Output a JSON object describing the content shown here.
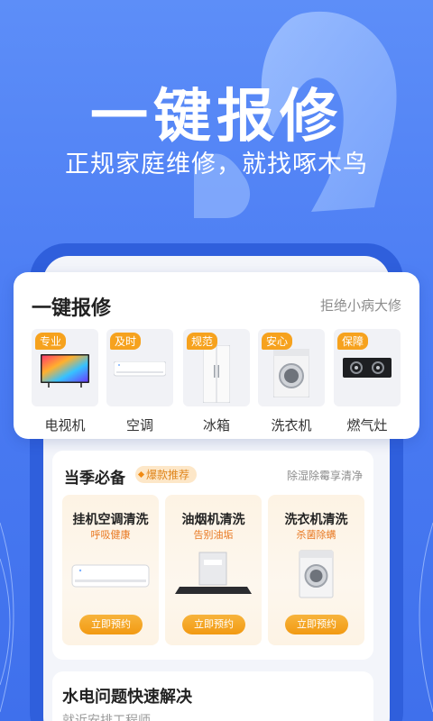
{
  "banner": {
    "title": "一键报修",
    "subtitle": "正规家庭维修，就找啄木鸟"
  },
  "repair": {
    "title": "一键报修",
    "slogan": "拒绝小病大修",
    "items": [
      {
        "tag": "专业",
        "name": "电视机",
        "icon": "tv-icon"
      },
      {
        "tag": "及时",
        "name": "空调",
        "icon": "air-conditioner-icon"
      },
      {
        "tag": "规范",
        "name": "冰箱",
        "icon": "fridge-icon"
      },
      {
        "tag": "安心",
        "name": "洗衣机",
        "icon": "washer-icon"
      },
      {
        "tag": "保障",
        "name": "燃气灶",
        "icon": "gas-stove-icon"
      }
    ]
  },
  "season": {
    "title": "当季必备",
    "badge": "爆款推荐",
    "hint": "除湿除霉享清净",
    "services": [
      {
        "name": "挂机空调清洗",
        "sub": "呼吸健康",
        "button": "立即预约",
        "icon": "air-conditioner-icon"
      },
      {
        "name": "油烟机清洗",
        "sub": "告别油垢",
        "button": "立即预约",
        "icon": "range-hood-icon"
      },
      {
        "name": "洗衣机清洗",
        "sub": "杀菌除螨",
        "button": "立即预约",
        "icon": "washer-icon"
      }
    ]
  },
  "water": {
    "title": "水电问题快速解决",
    "subtitle": "就近安排工程师"
  },
  "colors": {
    "primary_blue": "#4b7cf3",
    "tag_orange": "#f6a21e",
    "accent_orange": "#e8771f"
  }
}
